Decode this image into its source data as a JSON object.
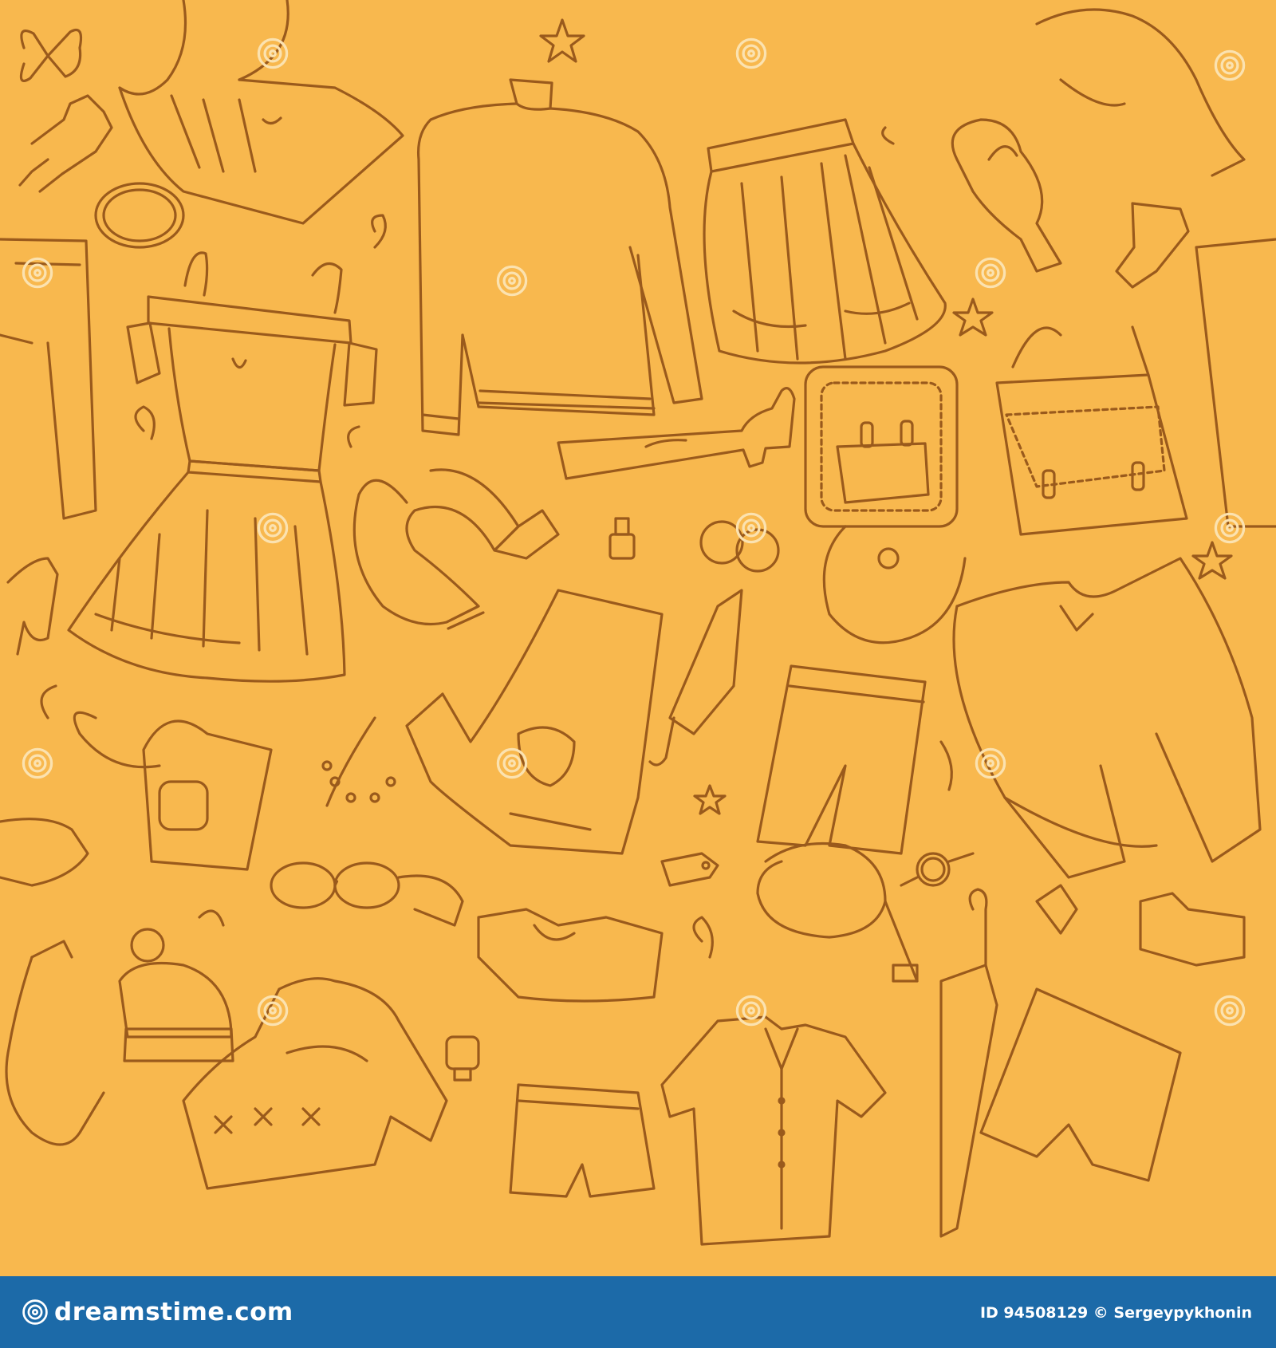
{
  "image": {
    "background_color": "#f8b84e",
    "line_color": "#9a5a1c",
    "subject": [
      "dress",
      "turtleneck-sweater",
      "skirt",
      "scarf",
      "backpack",
      "messenger-bag",
      "high-heel-boot",
      "tshirt",
      "shorts",
      "umbrella",
      "belt",
      "glove",
      "sock",
      "beanie-hat",
      "blouse",
      "tank-top",
      "handbag",
      "necklace",
      "watch",
      "price-tag",
      "nail-polish",
      "sunglasses",
      "star",
      "perfume-bottle",
      "jeans",
      "hat"
    ]
  },
  "footer": {
    "background_color": "#1c6aa8",
    "brand_text": "dreamstime.com",
    "image_id": "ID 94508129",
    "copyright": "©",
    "author": "Sergeypykhonin",
    "credit_text": "ID 94508129 © Sergeypykhonin"
  }
}
